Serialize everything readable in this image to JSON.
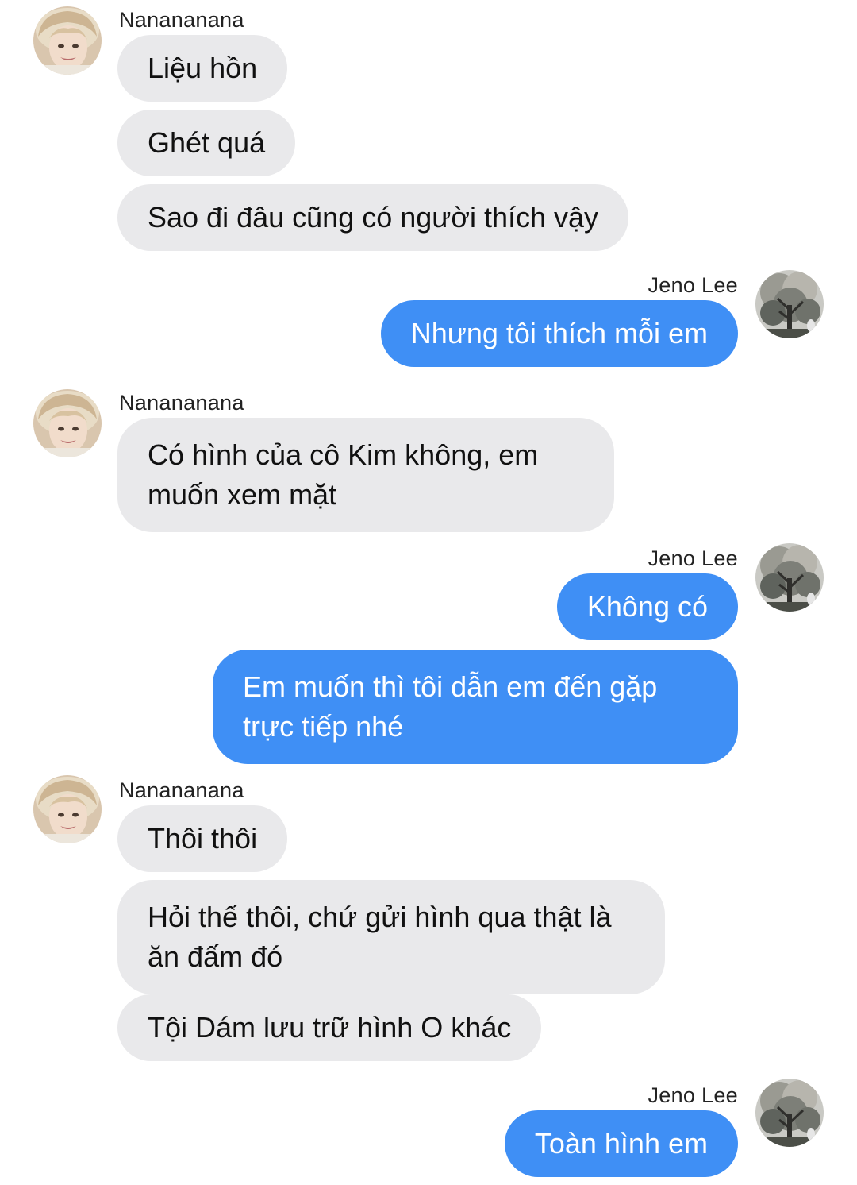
{
  "contacts": {
    "them": {
      "name": "Nanananana",
      "avatar_icon": "face-photo-avatar-icon"
    },
    "me": {
      "name": "Jeno Lee",
      "avatar_icon": "tree-photo-avatar-icon"
    }
  },
  "colors": {
    "incoming_bubble": "#e9e9eb",
    "outgoing_bubble": "#3f8ff5",
    "outgoing_text": "#ffffff",
    "incoming_text": "#111111"
  },
  "messages": {
    "m1": "Liệu hồn",
    "m2": "Ghét quá",
    "m3": "Sao đi đâu cũng có người thích vậy",
    "m4": "Nhưng tôi thích mỗi em",
    "m5": "Có hình của cô Kim không, em muốn xem mặt",
    "m6": "Không có",
    "m7": "Em muốn thì tôi dẫn em đến gặp trực tiếp nhé",
    "m8": "Thôi thôi",
    "m9": "Hỏi thế thôi, chứ gửi hình qua thật là ăn đấm đó",
    "m10": "Tội Dám lưu trữ hình O khác",
    "m11": "Toàn hình em"
  }
}
